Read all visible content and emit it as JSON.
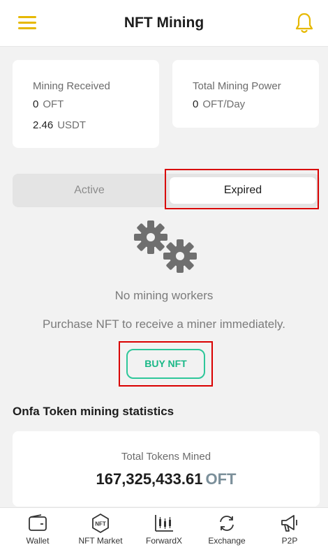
{
  "header": {
    "title": "NFT Mining",
    "menu_icon": "hamburger-menu-icon",
    "bell_icon": "bell-icon",
    "accent_color": "#e6b800"
  },
  "stats": {
    "received": {
      "label": "Mining Received",
      "oft_value": "0",
      "oft_unit": "OFT",
      "usdt_value": "2.46",
      "usdt_unit": "USDT"
    },
    "power": {
      "label": "Total Mining Power",
      "value": "0",
      "unit": "OFT/Day"
    }
  },
  "tabs": [
    {
      "label": "Active",
      "selected": false
    },
    {
      "label": "Expired",
      "selected": true
    }
  ],
  "empty_state": {
    "icon": "gears-icon",
    "title": "No mining workers",
    "subtitle": "Purchase NFT to receive a miner immediately.",
    "button_label": "BUY NFT",
    "button_color": "#2ec79a"
  },
  "token_stats": {
    "section_title": "Onfa Token mining statistics",
    "label": "Total Tokens Mined",
    "value": "167,325,433.61",
    "unit": "OFT"
  },
  "bottom_nav": [
    {
      "label": "Wallet",
      "icon": "wallet-icon"
    },
    {
      "label": "NFT Market",
      "icon": "nft-icon"
    },
    {
      "label": "ForwardX",
      "icon": "chart-bars-icon"
    },
    {
      "label": "Exchange",
      "icon": "exchange-icon"
    },
    {
      "label": "P2P",
      "icon": "megaphone-icon"
    }
  ],
  "highlight_color": "#d90000"
}
